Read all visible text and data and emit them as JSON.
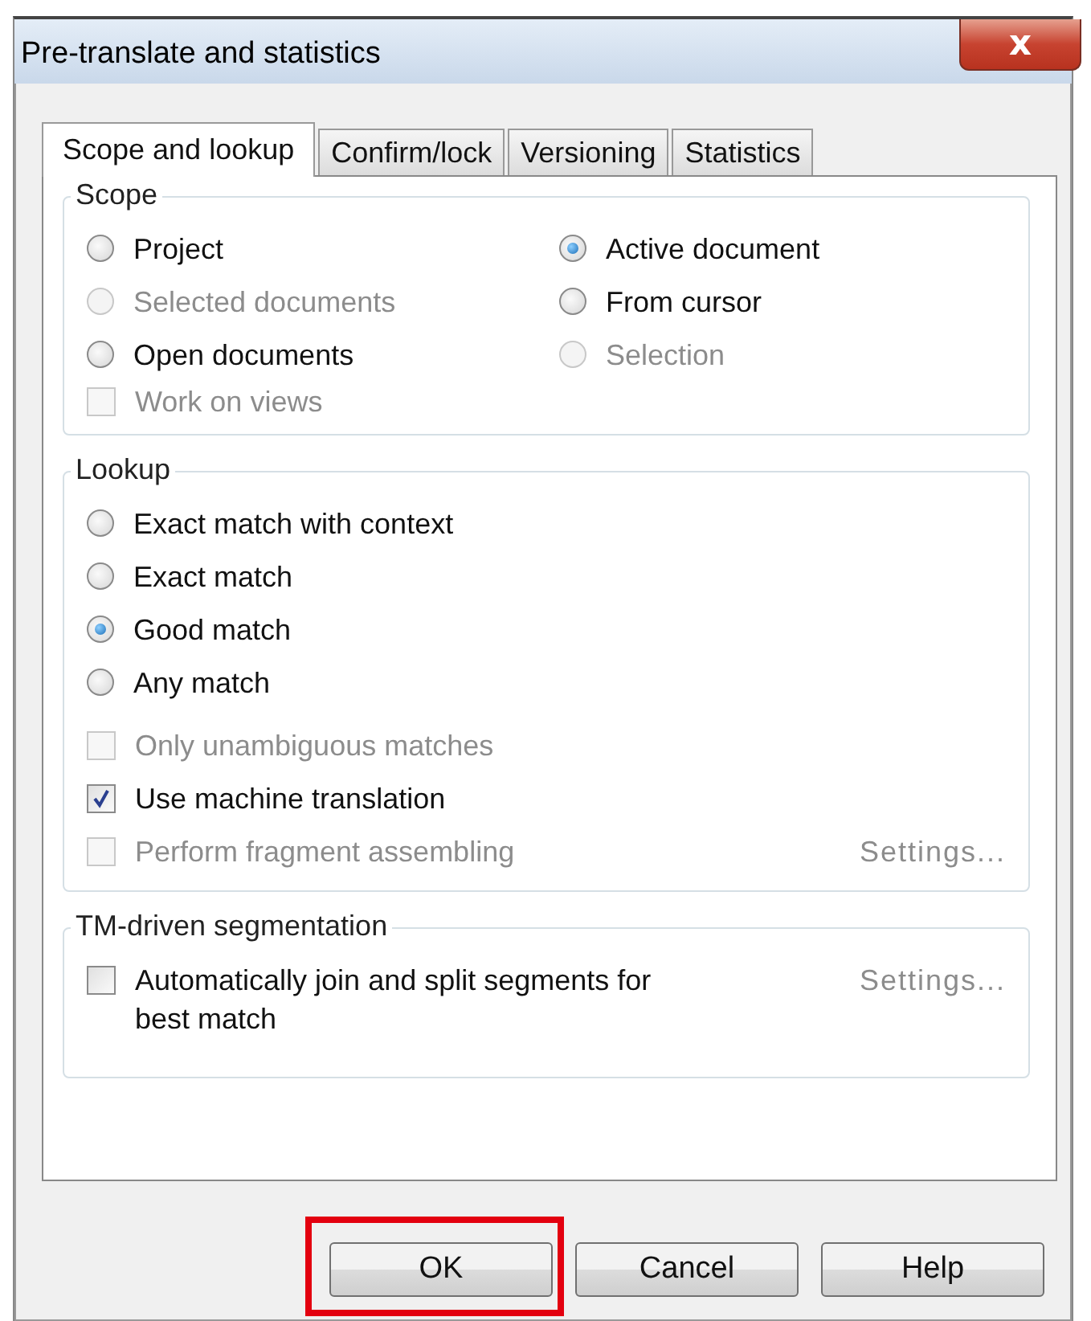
{
  "window": {
    "title": "Pre-translate and statistics",
    "close": "x"
  },
  "tabs": [
    {
      "label": "Scope and lookup",
      "selected": true
    },
    {
      "label": "Confirm/lock",
      "selected": false
    },
    {
      "label": "Versioning",
      "selected": false
    },
    {
      "label": "Statistics",
      "selected": false
    }
  ],
  "scope": {
    "title": "Scope",
    "options": [
      {
        "kind": "radio",
        "label": "Project",
        "selected": false,
        "disabled": false
      },
      {
        "kind": "radio",
        "label": "Active document",
        "selected": true,
        "disabled": false
      },
      {
        "kind": "radio",
        "label": "Selected documents",
        "selected": false,
        "disabled": true
      },
      {
        "kind": "radio",
        "label": "From cursor",
        "selected": false,
        "disabled": false
      },
      {
        "kind": "radio",
        "label": "Open documents",
        "selected": false,
        "disabled": false
      },
      {
        "kind": "radio",
        "label": "Selection",
        "selected": false,
        "disabled": true
      },
      {
        "kind": "checkbox",
        "label": "Work on views",
        "checked": false,
        "disabled": true
      }
    ]
  },
  "lookup": {
    "title": "Lookup",
    "options": [
      {
        "kind": "radio",
        "label": "Exact match with context",
        "selected": false,
        "disabled": false
      },
      {
        "kind": "radio",
        "label": "Exact match",
        "selected": false,
        "disabled": false
      },
      {
        "kind": "radio",
        "label": "Good match",
        "selected": true,
        "disabled": false
      },
      {
        "kind": "radio",
        "label": "Any match",
        "selected": false,
        "disabled": false
      },
      {
        "kind": "checkbox",
        "label": "Only unambiguous matches",
        "checked": false,
        "disabled": true
      },
      {
        "kind": "checkbox",
        "label": "Use machine translation",
        "checked": true,
        "disabled": false
      },
      {
        "kind": "checkbox",
        "label": "Perform fragment assembling",
        "checked": false,
        "disabled": true,
        "settings": {
          "label": "Settings...",
          "disabled": true
        }
      }
    ]
  },
  "segmentation": {
    "title": "TM-driven segmentation",
    "options": [
      {
        "kind": "checkbox",
        "label": "Automatically join and split segments for best match",
        "checked": false,
        "disabled": false,
        "settings": {
          "label": "Settings...",
          "disabled": true
        }
      }
    ]
  },
  "buttons": [
    {
      "label": "OK",
      "highlighted": true
    },
    {
      "label": "Cancel",
      "highlighted": false
    },
    {
      "label": "Help",
      "highlighted": false
    }
  ]
}
